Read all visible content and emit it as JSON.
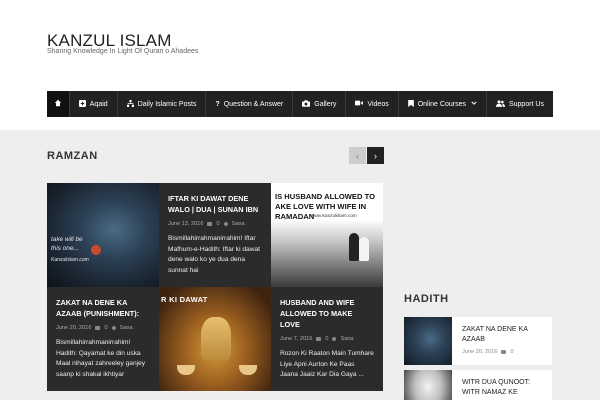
{
  "site": {
    "title": "KANZUL ISLAM",
    "tagline": "Sharing Knowledge In Light Of Quran o Ahadees"
  },
  "nav": {
    "items": [
      {
        "label": "",
        "icon": "home-icon"
      },
      {
        "label": "Aqaid",
        "icon": "plus-square-icon"
      },
      {
        "label": "Daily Islamic Posts",
        "icon": "sitemap-icon"
      },
      {
        "label": "Question & Answer",
        "icon": "question-icon"
      },
      {
        "label": "Gallery",
        "icon": "camera-icon"
      },
      {
        "label": "Videos",
        "icon": "video-camera-icon"
      },
      {
        "label": "Online Courses",
        "icon": "bookmark-icon"
      },
      {
        "label": "Support Us",
        "icon": "users-icon"
      }
    ]
  },
  "ramzan": {
    "title": "RAMZAN",
    "prev": "‹",
    "next": "›",
    "images": {
      "snake_text": "take will be\nthis one...",
      "snake_site": "Kanzulislam.com",
      "couple_text": "IS HUSBAND ALLOWED TO\nAKE LOVE WITH WIFE IN RAMADAN",
      "couple_site": "www.Kanzulislam.com",
      "tea_text": "R KI DAWAT"
    },
    "posts": [
      {
        "title": "IFTAR KI DAWAT DENE WALO | DUA | SUNAN IBN",
        "date": "June 13, 2016",
        "comments": "0",
        "author": "Sana",
        "excerpt": "Bismillahirrahmanirrahim! Iftar Mafhum-e-Hadith: Iftar ki dawat dene walo ko ye dua dena sunnat hai"
      },
      {
        "title": "ZAKAT NA DENE KA AZAAB (PUNISHMENT):",
        "date": "June 20, 2016",
        "comments": "0",
        "author": "Sana",
        "excerpt": "Bismillahirrahmanirrahim! Hadith: Qayamat ke din uska Maal nihayat zahreeley ganjey saanp ki shakal ikhtiyar"
      },
      {
        "title": "HUSBAND AND WIFE ALLOWED TO MAKE LOVE",
        "date": "June 7, 2016",
        "comments": "0",
        "author": "Sana",
        "excerpt": "Rozon Ki Raaton Main Tumhare Liye Apni Aurton Ke Paas Jaana Jaaiz Kar Dia Gaya ..."
      }
    ]
  },
  "hadith": {
    "title": "HADITH",
    "items": [
      {
        "title": "ZAKAT NA DENE KA AZAAB",
        "date": "June 20, 2016",
        "comments": "0"
      },
      {
        "title": "WITR DUA QUNOOT: WITR NAMAZ KE",
        "date": "",
        "comments": ""
      }
    ]
  }
}
